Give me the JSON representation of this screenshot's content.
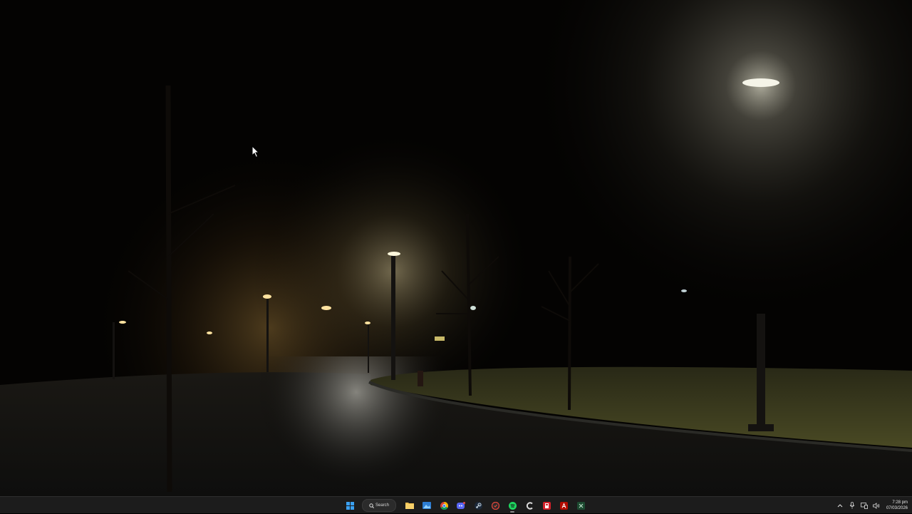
{
  "desktop": {
    "wallpaper": "foggy-night-street-lamps",
    "cursor": "arrow-pointer-icon"
  },
  "taskbar": {
    "search_label": "Search",
    "pinned": [
      {
        "name": "start-button",
        "icon": "windows-icon"
      },
      {
        "name": "file-explorer",
        "icon": "folder-icon"
      },
      {
        "name": "photos",
        "icon": "photos-icon"
      },
      {
        "name": "chrome",
        "icon": "chrome-icon"
      },
      {
        "name": "discord",
        "icon": "discord-icon"
      },
      {
        "name": "steam",
        "icon": "steam-icon"
      },
      {
        "name": "app-shield",
        "icon": "shield-icon"
      },
      {
        "name": "spotify",
        "icon": "spotify-icon"
      },
      {
        "name": "ccleaner",
        "icon": "ccleaner-icon"
      },
      {
        "name": "app-red",
        "icon": "red-app-icon"
      },
      {
        "name": "acrobat",
        "icon": "acrobat-icon"
      },
      {
        "name": "excel",
        "icon": "excel-icon"
      }
    ],
    "tray": {
      "chevron": "chevron-up-icon",
      "mic": "microphone-icon",
      "network": "network-icon",
      "volume": "speaker-icon"
    },
    "clock": {
      "time": "7:28 pm",
      "date": "07/03/2026"
    }
  }
}
